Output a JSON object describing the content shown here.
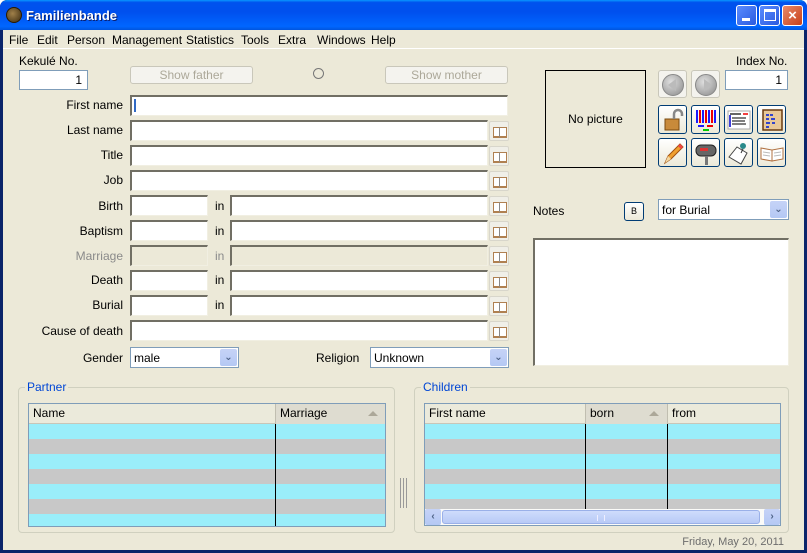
{
  "window": {
    "title": "Familienbande",
    "controls": {
      "minimize": "minimize",
      "maximize": "maximize",
      "close": "×"
    }
  },
  "menu": [
    "File",
    "Edit",
    "Person",
    "Management",
    "Statistics",
    "Tools",
    "Extra",
    "Windows",
    "Help"
  ],
  "kekule": {
    "label": "Kekulé No.",
    "value": "1"
  },
  "index": {
    "label": "Index No.",
    "value": "1"
  },
  "parents": {
    "father_button": "Show father",
    "mother_button": "Show mother"
  },
  "picture": {
    "placeholder": "No picture"
  },
  "fields": {
    "first_name": {
      "label": "First name",
      "value": ""
    },
    "last_name": {
      "label": "Last name",
      "value": ""
    },
    "title": {
      "label": "Title",
      "value": ""
    },
    "job": {
      "label": "Job",
      "value": ""
    },
    "birth": {
      "label": "Birth",
      "in": "in",
      "date": "",
      "place": ""
    },
    "baptism": {
      "label": "Baptism",
      "in": "in",
      "date": "",
      "place": ""
    },
    "marriage": {
      "label": "Marriage",
      "in": "in",
      "date": "",
      "place": "",
      "disabled": true
    },
    "death": {
      "label": "Death",
      "in": "in",
      "date": "",
      "place": ""
    },
    "burial": {
      "label": "Burial",
      "in": "in",
      "date": "",
      "place": ""
    },
    "cause_of_death": {
      "label": "Cause of death",
      "value": ""
    },
    "gender": {
      "label": "Gender",
      "value": "male"
    },
    "religion": {
      "label": "Religion",
      "value": "Unknown"
    }
  },
  "notes": {
    "label": "Notes",
    "bold_button": "B",
    "selector_value": "for Burial",
    "text": ""
  },
  "toolbar_icons": [
    "lock-open-icon",
    "barcode-chart-icon",
    "text-list-icon",
    "scroll-document-icon",
    "pencil-icon",
    "mailbox-icon",
    "pinned-note-icon",
    "open-book-icon"
  ],
  "partner": {
    "legend": "Partner",
    "columns": [
      "Name",
      "Marriage"
    ],
    "sorted_column": "Marriage",
    "rows": [
      [
        "",
        ""
      ],
      [
        "",
        ""
      ],
      [
        "",
        ""
      ],
      [
        "",
        ""
      ],
      [
        "",
        ""
      ],
      [
        "",
        ""
      ],
      [
        "",
        ""
      ]
    ]
  },
  "children": {
    "legend": "Children",
    "columns": [
      "First name",
      "born",
      "from"
    ],
    "sorted_column": "born",
    "rows": [
      [
        "",
        "",
        ""
      ],
      [
        "",
        "",
        ""
      ],
      [
        "",
        "",
        ""
      ],
      [
        "",
        "",
        ""
      ],
      [
        "",
        "",
        ""
      ],
      [
        "",
        "",
        ""
      ]
    ]
  },
  "status": {
    "date": "Friday, May 20, 2011"
  },
  "colors": {
    "row_cyan": "#9aeefa",
    "row_gray": "#c8c8c8",
    "legend_blue": "#0046d5",
    "titlebar": "#0055e5"
  }
}
